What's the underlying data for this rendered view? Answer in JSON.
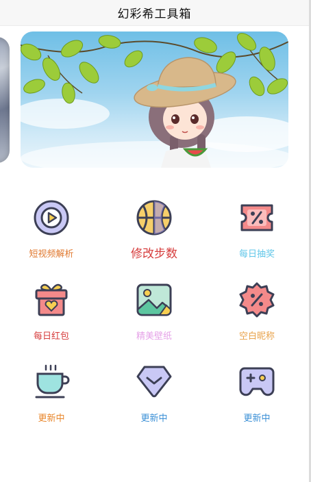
{
  "header": {
    "title": "幻彩希工具箱"
  },
  "banner": {
    "image_description_icon": "girl-with-hat-icon"
  },
  "tools": [
    {
      "label": "短视频解析",
      "color": "#e0782e",
      "icon": "play-icon"
    },
    {
      "label": "修改步数",
      "color": "#d63c3c",
      "icon": "basketball-icon"
    },
    {
      "label": "每日抽奖",
      "color": "#5fc6e8",
      "icon": "coupon-icon"
    },
    {
      "label": "每日红包",
      "color": "#d63c3c",
      "icon": "gift-icon"
    },
    {
      "label": "精美壁纸",
      "color": "#e6a3e8",
      "icon": "picture-icon"
    },
    {
      "label": "空白昵称",
      "color": "#e8a24a",
      "icon": "discount-badge-icon"
    },
    {
      "label": "更新中",
      "color": "#e8852a",
      "icon": "coffee-cup-icon"
    },
    {
      "label": "更新中",
      "color": "#3a8fd6",
      "icon": "diamond-icon"
    },
    {
      "label": "更新中",
      "color": "#3a8fd6",
      "icon": "gamepad-icon"
    }
  ]
}
